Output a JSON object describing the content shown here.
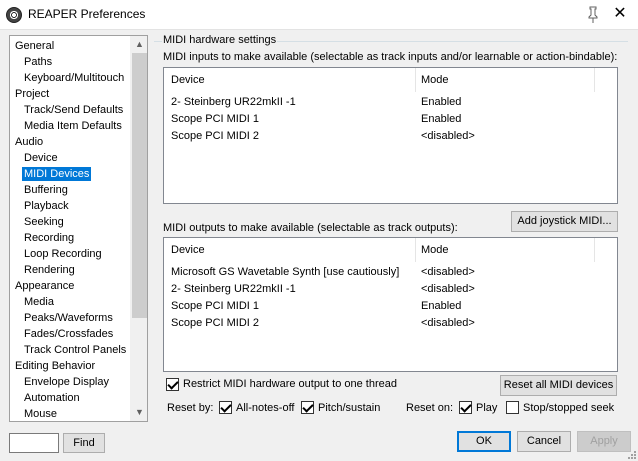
{
  "window": {
    "title": "REAPER Preferences"
  },
  "tree": {
    "items": [
      {
        "label": "General",
        "level": 0
      },
      {
        "label": "Paths",
        "level": 1
      },
      {
        "label": "Keyboard/Multitouch",
        "level": 1
      },
      {
        "label": "Project",
        "level": 0
      },
      {
        "label": "Track/Send Defaults",
        "level": 1
      },
      {
        "label": "Media Item Defaults",
        "level": 1
      },
      {
        "label": "Audio",
        "level": 0
      },
      {
        "label": "Device",
        "level": 1
      },
      {
        "label": "MIDI Devices",
        "level": 1,
        "selected": true
      },
      {
        "label": "Buffering",
        "level": 1
      },
      {
        "label": "Playback",
        "level": 1
      },
      {
        "label": "Seeking",
        "level": 1
      },
      {
        "label": "Recording",
        "level": 1
      },
      {
        "label": "Loop Recording",
        "level": 1
      },
      {
        "label": "Rendering",
        "level": 1
      },
      {
        "label": "Appearance",
        "level": 0
      },
      {
        "label": "Media",
        "level": 1
      },
      {
        "label": "Peaks/Waveforms",
        "level": 1
      },
      {
        "label": "Fades/Crossfades",
        "level": 1
      },
      {
        "label": "Track Control Panels",
        "level": 1
      },
      {
        "label": "Editing Behavior",
        "level": 0
      },
      {
        "label": "Envelope Display",
        "level": 1
      },
      {
        "label": "Automation",
        "level": 1
      },
      {
        "label": "Mouse",
        "level": 1
      }
    ]
  },
  "midi": {
    "group_title": "MIDI hardware settings",
    "inputs_label": "MIDI inputs to make available (selectable as track inputs and/or learnable or action-bindable):",
    "outputs_label": "MIDI outputs to make available (selectable as track outputs):",
    "col_device": "Device",
    "col_mode": "Mode",
    "inputs": [
      {
        "device": "2- Steinberg UR22mkII -1",
        "mode": "Enabled"
      },
      {
        "device": "Scope PCI MIDI 1",
        "mode": "Enabled"
      },
      {
        "device": "Scope PCI MIDI 2",
        "mode": "<disabled>"
      }
    ],
    "outputs": [
      {
        "device": "Microsoft GS Wavetable Synth [use cautiously]",
        "mode": "<disabled>"
      },
      {
        "device": "2- Steinberg UR22mkII -1",
        "mode": "<disabled>"
      },
      {
        "device": "Scope PCI MIDI 1",
        "mode": "Enabled"
      },
      {
        "device": "Scope PCI MIDI 2",
        "mode": "<disabled>"
      }
    ],
    "add_joystick_label": "Add joystick MIDI...",
    "restrict_label": "Restrict MIDI hardware output to one thread",
    "restrict_checked": true,
    "reset_all_label": "Reset all MIDI devices",
    "reset_by_label": "Reset by:",
    "all_notes_off_label": "All-notes-off",
    "pitch_sustain_label": "Pitch/sustain",
    "reset_on_label": "Reset on:",
    "play_label": "Play",
    "stop_label": "Stop/stopped seek"
  },
  "footer": {
    "find_value": "",
    "find_label": "Find",
    "ok_label": "OK",
    "cancel_label": "Cancel",
    "apply_label": "Apply"
  }
}
